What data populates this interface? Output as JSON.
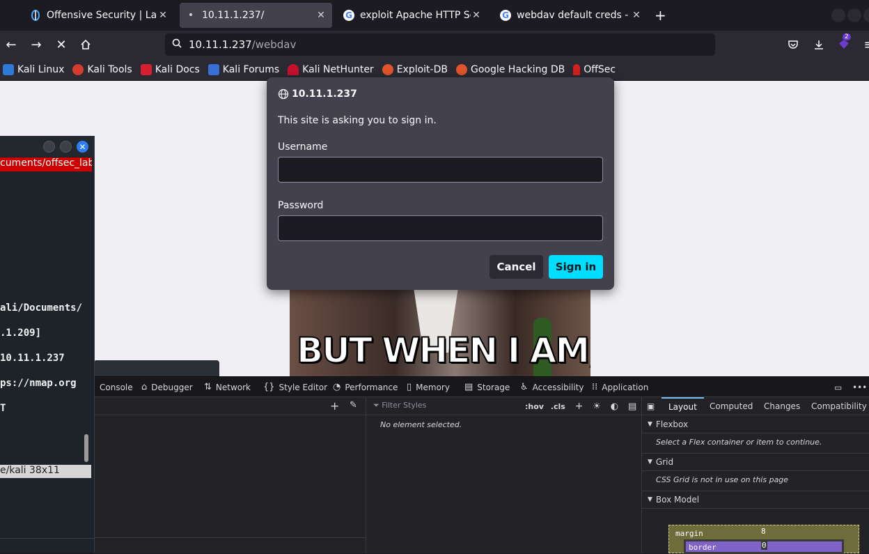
{
  "tabs": [
    {
      "title": "Offensive Security | Labs",
      "icon": "offsec-logo-icon"
    },
    {
      "title": "10.11.1.237/",
      "icon": "loading-dot-icon"
    },
    {
      "title": "exploit Apache HTTP Serv",
      "icon": "google-icon"
    },
    {
      "title": "webdav default creds - Go",
      "icon": "google-icon"
    }
  ],
  "url": {
    "host": "10.11.1.237",
    "path": "/webdav"
  },
  "bookmarks": [
    {
      "label": "Kali Linux",
      "color": "#2f7ad6"
    },
    {
      "label": "Kali Tools",
      "color": "#d63b2f"
    },
    {
      "label": "Kali Docs",
      "color": "#d6202f"
    },
    {
      "label": "Kali Forums",
      "color": "#3a6fd6"
    },
    {
      "label": "Kali NetHunter",
      "color": "#c8102e"
    },
    {
      "label": "Exploit-DB",
      "color": "#e2552b"
    },
    {
      "label": "Google Hacking DB",
      "color": "#e2552b"
    },
    {
      "label": "OffSec",
      "color": "#d61f1f"
    }
  ],
  "extension_badge": "2",
  "auth": {
    "host": "10.11.1.237",
    "message": "This site is asking you to sign in.",
    "username_label": "Username",
    "password_label": "Password",
    "cancel": "Cancel",
    "signin": "Sign in"
  },
  "meme_caption": "BUT WHEN I AM, I'LL",
  "terminal": {
    "path": "cuments/offsec_labs",
    "lines": [
      "ali/Documents/",
      ".1.209]",
      "  10.11.1.237",
      "ps://nmap.org",
      "T"
    ],
    "status": "e/kali 38x11"
  },
  "devtools": {
    "tabs": [
      "Console",
      "Debugger",
      "Network",
      "Style Editor",
      "Performance",
      "Memory",
      "Storage",
      "Accessibility",
      "Application"
    ],
    "filter_placeholder": "Filter Styles",
    "hov": ":hov",
    "cls": ".cls",
    "no_element": "No element selected.",
    "right_tabs": [
      "Layout",
      "Computed",
      "Changes",
      "Compatibility"
    ],
    "flexbox": {
      "title": "Flexbox",
      "msg": "Select a Flex container or item to continue."
    },
    "grid": {
      "title": "Grid",
      "msg": "CSS Grid is not in use on this page"
    },
    "boxmodel": {
      "title": "Box Model",
      "margin_label": "margin",
      "margin_value": "8",
      "border_label": "border",
      "border_value": "0"
    }
  }
}
